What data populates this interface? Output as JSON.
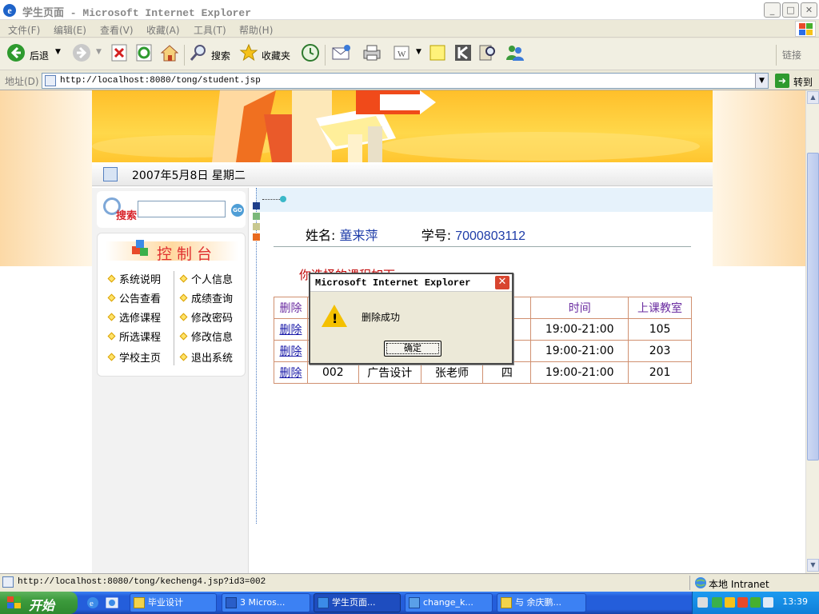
{
  "window": {
    "title": "学生页面 - Microsoft Internet Explorer",
    "min_label": "_",
    "max_label": "□",
    "close_label": "✕"
  },
  "menu": [
    "文件(F)",
    "编辑(E)",
    "查看(V)",
    "收藏(A)",
    "工具(T)",
    "帮助(H)"
  ],
  "toolbar": {
    "back_label": "后退",
    "search_label": "搜索",
    "favorites_label": "收藏夹",
    "links_label": "链接"
  },
  "address": {
    "label": "地址(D)",
    "url": "http://localhost:8080/tong/student.jsp",
    "go_label": "转到"
  },
  "page": {
    "date": "2007年5月8日  星期二",
    "search_label": "搜索",
    "search_go": "GO",
    "control_title": "控制台",
    "left_menu": [
      "系统说明",
      "公告查看",
      "选修课程",
      "所选课程",
      "学校主页"
    ],
    "right_menu": [
      "个人信息",
      "成绩查询",
      "修改密码",
      "修改信息",
      "退出系统"
    ],
    "name_key": "姓名:",
    "name_value": "童来萍",
    "id_key": "学号:",
    "id_value": "7000803112",
    "note": "你选择的课程如下",
    "table": {
      "headers": [
        "删除",
        "",
        "",
        "",
        "几",
        "时间",
        "上课教室"
      ],
      "rows": [
        [
          "删除",
          "",
          "",
          "",
          "",
          "19:00-21:00",
          "105"
        ],
        [
          "删除",
          "",
          "",
          "",
          "",
          "19:00-21:00",
          "203"
        ],
        [
          "删除",
          "002",
          "广告设计",
          "张老师",
          "四",
          "19:00-21:00",
          "201"
        ]
      ]
    }
  },
  "status": {
    "url": "http://localhost:8080/tong/kecheng4.jsp?id3=002",
    "zone": "本地 Intranet"
  },
  "taskbar": {
    "start_label": "开始",
    "items": [
      "毕业设计",
      "3 Micros...",
      "学生页面...",
      "change_k...",
      "与 余庆鹏..."
    ],
    "clock": "13:39"
  },
  "dialog": {
    "title": "Microsoft Internet Explorer",
    "message": "删除成功",
    "ok_label": "确定"
  },
  "colors": {
    "accent": "#245edb",
    "banner": "#ffc52f",
    "alert_red": "#c00000",
    "link_blue": "#1a1aa8"
  }
}
